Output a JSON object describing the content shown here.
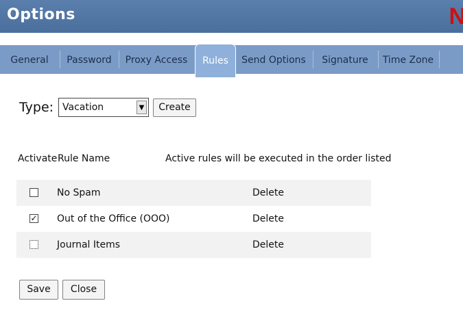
{
  "title": "Options",
  "logo": "N",
  "tabs": [
    {
      "label": "General",
      "active": false
    },
    {
      "label": "Password",
      "active": false
    },
    {
      "label": "Proxy Access",
      "active": false
    },
    {
      "label": "Rules",
      "active": true
    },
    {
      "label": "Send Options",
      "active": false
    },
    {
      "label": "Signature",
      "active": false
    },
    {
      "label": "Time Zone",
      "active": false
    }
  ],
  "type_label": "Type:",
  "type_select": {
    "value": "Vacation"
  },
  "create_label": "Create",
  "headers": {
    "activate": "Activate",
    "rule_name": "Rule Name",
    "note": "Active rules will be executed in the order listed"
  },
  "rules": [
    {
      "name": "No Spam",
      "active": false,
      "delete": "Delete"
    },
    {
      "name": "Out of the Office (OOO)",
      "active": true,
      "delete": "Delete"
    },
    {
      "name": "Journal Items",
      "active": false,
      "delete": "Delete"
    }
  ],
  "save_label": "Save",
  "close_label": "Close",
  "colors": {
    "header_bg": "#4a6f9c",
    "tab_bg": "#7b9bc7",
    "logo": "#cc1111"
  }
}
